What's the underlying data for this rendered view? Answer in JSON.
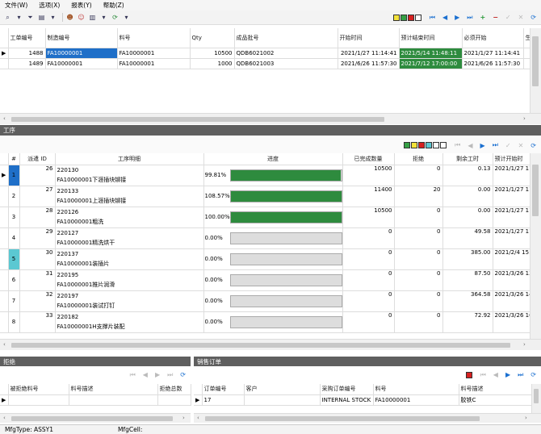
{
  "menu": [
    "文件(W)",
    "选项(X)",
    "报表(Y)",
    "帮助(Z)"
  ],
  "top_grid": {
    "columns": [
      "工单编号",
      "制造编号",
      "料号",
      "Qty",
      "成品批号",
      "开始时间",
      "预计结束时间",
      "必须开始",
      "生"
    ],
    "rows": [
      {
        "wo": "1488",
        "mfg": "FA10000001",
        "part": "FA10000001",
        "qty": "10500",
        "lot": "QDB6021002",
        "start": "2021/1/27 11:14:41",
        "end": "2021/5/14 11:48:11",
        "must": "2021/1/27 11:14:41"
      },
      {
        "wo": "1489",
        "mfg": "FA10000001",
        "part": "FA10000001",
        "qty": "1000",
        "lot": "QDB6021003",
        "start": "2021/6/26 11:57:30",
        "end": "2021/7/12 17:00:00",
        "must": "2021/6/26 11:57:30"
      }
    ]
  },
  "ops_section": {
    "title": "工序",
    "columns": [
      "#",
      "派遣 ID",
      "工序明细",
      "进度",
      "已完成数量",
      "拒绝",
      "剩余工时",
      "预计开始时"
    ],
    "rows": [
      {
        "n": "1",
        "id": "26",
        "code": "220130",
        "desc": "FA10000001下涯插块铆接",
        "pct": "99.81%",
        "progress": 0.9981,
        "done": "10500",
        "rej": "0",
        "rem": "0.13",
        "est": "2021/1/27 11:1",
        "flag": "#1f6fc8"
      },
      {
        "n": "2",
        "id": "27",
        "code": "220133",
        "desc": "FA10000001上涯插块铆接",
        "pct": "108.57%",
        "progress": 1.0,
        "done": "11400",
        "rej": "20",
        "rem": "0.00",
        "est": "2021/1/27 11:1",
        "flag": ""
      },
      {
        "n": "3",
        "id": "28",
        "code": "220126",
        "desc": "FA10000001粗洗",
        "pct": "100.00%",
        "progress": 1.0,
        "done": "10500",
        "rej": "0",
        "rem": "0.00",
        "est": "2021/1/27 11:1",
        "flag": ""
      },
      {
        "n": "4",
        "id": "29",
        "code": "220127",
        "desc": "FA10000001精洗烘干",
        "pct": "0.00%",
        "progress": 0,
        "done": "0",
        "rej": "0",
        "rem": "49.58",
        "est": "2021/1/27 11:1",
        "flag": ""
      },
      {
        "n": "5",
        "id": "30",
        "code": "220137",
        "desc": "FA10000001装插片",
        "pct": "0.00%",
        "progress": 0,
        "done": "0",
        "rej": "0",
        "rem": "385.00",
        "est": "2021/2/4 15:57",
        "flag": "#5bc8d2"
      },
      {
        "n": "6",
        "id": "31",
        "code": "220195",
        "desc": "FA10000001推片润滑",
        "pct": "0.00%",
        "progress": 0,
        "done": "0",
        "rej": "0",
        "rem": "87.50",
        "est": "2021/3/26 13:5",
        "flag": ""
      },
      {
        "n": "7",
        "id": "32",
        "code": "220197",
        "desc": "FA10000001装试打钉",
        "pct": "0.00%",
        "progress": 0,
        "done": "0",
        "rej": "0",
        "rem": "364.58",
        "est": "2021/3/26 14:2",
        "flag": ""
      },
      {
        "n": "8",
        "id": "33",
        "code": "220182",
        "desc": "FA10000001H支撑片装配",
        "pct": "0.00%",
        "progress": 0,
        "done": "0",
        "rej": "0",
        "rem": "72.92",
        "est": "2021/3/26 16:0",
        "flag": ""
      }
    ]
  },
  "reject_section": {
    "title": "拒绝",
    "columns": [
      "被拒绝料号",
      "料号描述",
      "拒绝总数"
    ]
  },
  "sales_section": {
    "title": "销售订单",
    "columns": [
      "订单编号",
      "客户",
      "采购订单编号",
      "料号",
      "料号描述"
    ],
    "row": {
      "order": "17",
      "customer": "",
      "po": "INTERNAL STOCK",
      "part": "FA10000001",
      "desc": "胶铁C"
    }
  },
  "status": {
    "mfg_type": "MfgType: ASSY1",
    "mfg_cell": "MfgCell:"
  },
  "colors": {
    "green": "#2e8b3e",
    "section": "#5f5f5f",
    "selected": "#1f6fc8",
    "nav": "#1a6fd0"
  }
}
